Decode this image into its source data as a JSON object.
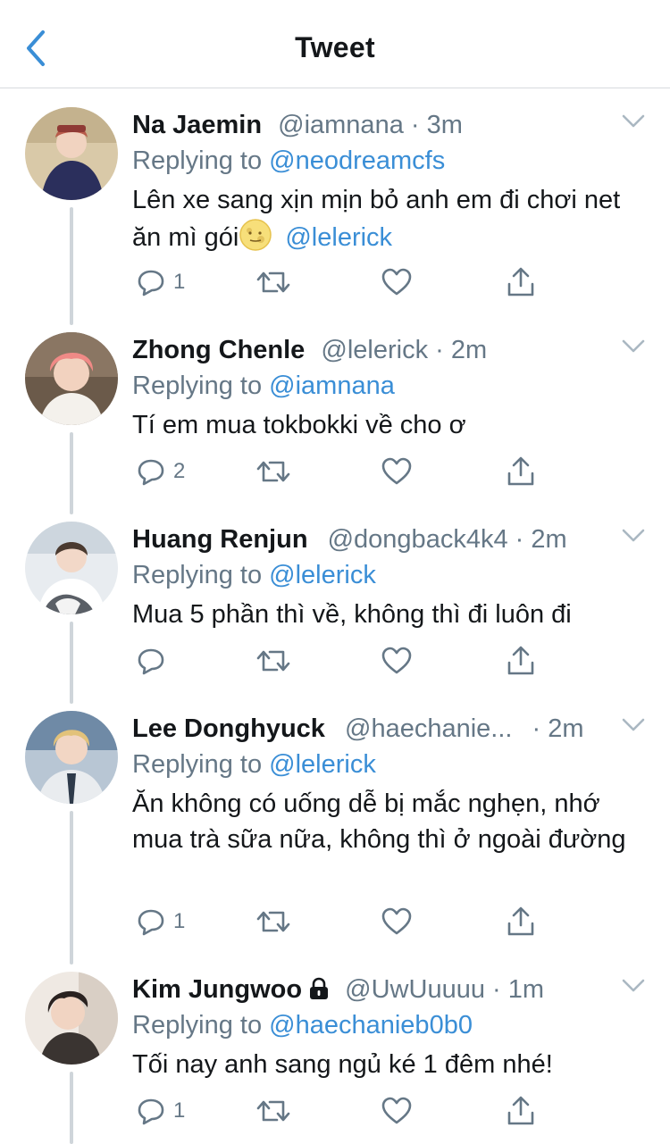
{
  "header": {
    "title": "Tweet"
  },
  "tweets": [
    {
      "name": "Na Jaemin",
      "handle": "@iamnana",
      "time": "3m",
      "replying_label": "Replying to",
      "replying_to": "@neodreamcfs",
      "text": "Lên xe sang xịn mịn bỏ anh em đi chơi net ăn mì gói",
      "mention": "@lelerick",
      "reply_count": "1"
    },
    {
      "name": "Zhong Chenle",
      "handle": "@lelerick",
      "time": "2m",
      "replying_label": "Replying to",
      "replying_to": "@iamnana",
      "text": "Tí em mua tokbokki về cho ơ",
      "reply_count": "2"
    },
    {
      "name": "Huang Renjun",
      "handle": "@dongback4k4",
      "time": "2m",
      "replying_label": "Replying to",
      "replying_to": "@lelerick",
      "text": "Mua 5 phần thì về, không thì đi luôn đi",
      "reply_count": ""
    },
    {
      "name": "Lee Donghyuck",
      "handle": "@haechanie...",
      "time": "2m",
      "replying_label": "Replying to",
      "replying_to": "@lelerick",
      "text": "Ăn không có uống dễ bị mắc nghẹn, nhớ mua trà sữa nữa, không thì ở ngoài đường",
      "reply_count": "1"
    },
    {
      "name": "Kim Jungwoo",
      "handle": "@UwUuuuu",
      "time": "1m",
      "replying_label": "Replying to",
      "replying_to": "@haechanieb0b0",
      "text": "Tối nay anh sang ngủ ké 1 đêm nhé!",
      "reply_count": "1"
    }
  ],
  "dot": "·",
  "icons": {
    "back": "chevron-left-icon",
    "caret": "chevron-down-icon",
    "reply": "reply-icon",
    "retweet": "retweet-icon",
    "like": "heart-icon",
    "share": "share-icon",
    "lock": "lock-icon"
  },
  "colors": {
    "link": "#3a8ed6",
    "muted": "#657786",
    "text": "#14171a",
    "thread": "#cfd5da"
  }
}
